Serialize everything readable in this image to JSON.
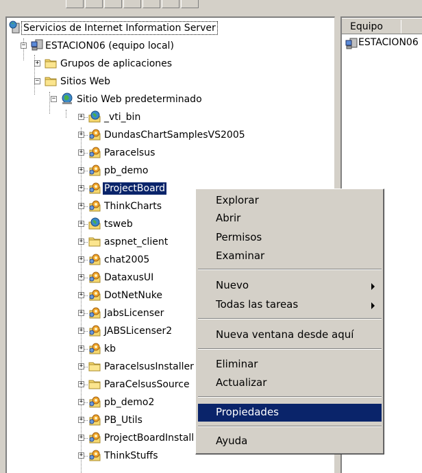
{
  "window": {
    "background": "#d4d0c8",
    "selection_color": "#0a246a"
  },
  "tree": {
    "root": "Servicios de Internet Information Server",
    "computer": "ESTACION06 (equipo local)",
    "app_pools": "Grupos de aplicaciones",
    "web_sites": "Sitios Web",
    "default_site": "Sitio Web predeterminado",
    "children": [
      {
        "label": "_vti_bin",
        "icon": "globe-app-icon"
      },
      {
        "label": "DundasChartSamplesVS2005",
        "icon": "gear-app-icon"
      },
      {
        "label": "Paracelsus",
        "icon": "gear-app-icon"
      },
      {
        "label": "pb_demo",
        "icon": "gear-app-icon"
      },
      {
        "label": "ProjectBoard",
        "icon": "gear-app-icon"
      },
      {
        "label": "ThinkCharts",
        "icon": "gear-app-icon"
      },
      {
        "label": "tsweb",
        "icon": "globe-app-icon"
      },
      {
        "label": "aspnet_client",
        "icon": "folder-icon"
      },
      {
        "label": "chat2005",
        "icon": "gear-app-icon"
      },
      {
        "label": "DataxusUI",
        "icon": "gear-app-icon"
      },
      {
        "label": "DotNetNuke",
        "icon": "gear-app-icon"
      },
      {
        "label": "JabsLicenser",
        "icon": "gear-app-icon"
      },
      {
        "label": "JABSLicenser2",
        "icon": "gear-app-icon"
      },
      {
        "label": "kb",
        "icon": "gear-app-icon"
      },
      {
        "label": "ParacelsusInstaller",
        "icon": "folder-icon"
      },
      {
        "label": "ParaCelsusSource",
        "icon": "folder-icon"
      },
      {
        "label": "pb_demo2",
        "icon": "gear-app-icon"
      },
      {
        "label": "PB_Utils",
        "icon": "gear-app-icon"
      },
      {
        "label": "ProjectBoardInstall",
        "icon": "gear-app-icon"
      },
      {
        "label": "ThinkStuffs",
        "icon": "gear-app-icon"
      }
    ]
  },
  "list": {
    "column_header": "Equipo",
    "items": [
      "ESTACION06"
    ]
  },
  "context_menu": {
    "explore": "Explorar",
    "open": "Abrir",
    "permissions": "Permisos",
    "browse": "Examinar",
    "new": "Nuevo",
    "all_tasks": "Todas las tareas",
    "new_window": "Nueva ventana desde aquí",
    "delete": "Eliminar",
    "refresh": "Actualizar",
    "properties": "Propiedades",
    "help": "Ayuda"
  }
}
